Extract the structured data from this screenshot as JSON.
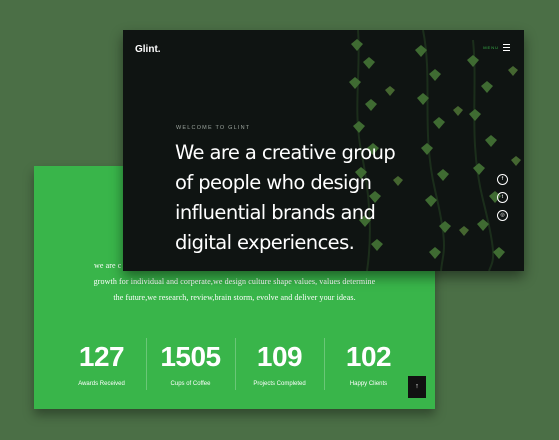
{
  "header": {
    "logo": "Glint.",
    "menu_label": "MENU"
  },
  "hero": {
    "eyebrow": "WELCOME TO GLINT",
    "headline_lines": [
      "We are a creative group",
      "of people who design",
      "influential brands and",
      "digital experiences."
    ]
  },
  "social": {
    "icons": [
      "facebook-icon",
      "twitter-icon",
      "instagram-icon"
    ],
    "glyphs": [
      "f",
      "t",
      "◎"
    ]
  },
  "about": {
    "lines": [
      "we are c",
      "growth for individual and corperate,we design culture shape values, values determine",
      "the future,we research, review,brain storm, evolve and deliver your ideas."
    ]
  },
  "stats": [
    {
      "value": "127",
      "label": "Awards Received"
    },
    {
      "value": "1505",
      "label": "Cups of Coffee"
    },
    {
      "value": "109",
      "label": "Projects Completed"
    },
    {
      "value": "102",
      "label": "Happy Clients"
    }
  ],
  "back_to_top": {
    "glyph": "↑"
  },
  "colors": {
    "background": "#4b6f46",
    "accent_green": "#39b54a",
    "dark": "#0f1412"
  }
}
